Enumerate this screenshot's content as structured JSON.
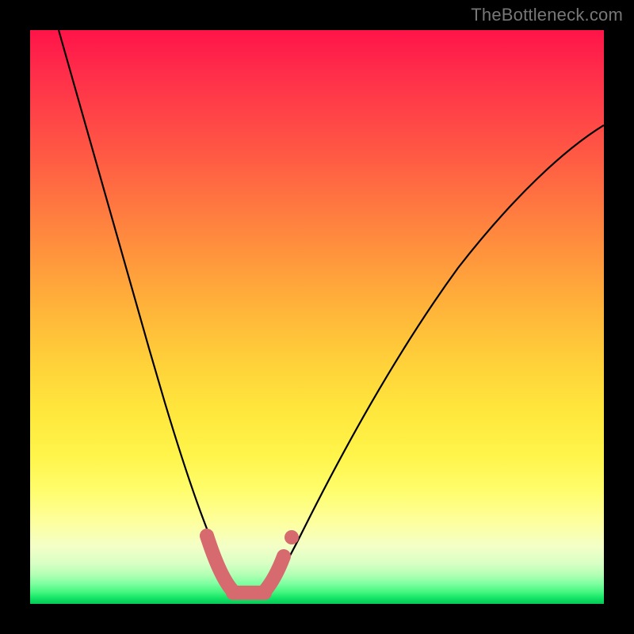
{
  "watermark": "TheBottleneck.com",
  "chart_data": {
    "type": "line",
    "title": "",
    "xlabel": "",
    "ylabel": "",
    "xlim": [
      0,
      100
    ],
    "ylim": [
      0,
      100
    ],
    "grid": false,
    "series": [
      {
        "name": "bottleneck-curve",
        "x": [
          5,
          8,
          11,
          14,
          17,
          20,
          23,
          26,
          28,
          30,
          31,
          32,
          33,
          34,
          35,
          36,
          37,
          38,
          40,
          42,
          45,
          50,
          55,
          60,
          65,
          70,
          75,
          80,
          85,
          90,
          95,
          100
        ],
        "y": [
          100,
          90,
          80,
          70,
          60,
          51,
          42,
          33,
          25,
          18,
          14,
          11,
          8,
          6,
          4,
          3,
          2.2,
          2,
          2,
          2.5,
          4,
          8,
          14,
          21,
          28,
          35,
          42,
          49,
          55,
          61,
          66,
          71
        ]
      },
      {
        "name": "trough-highlight",
        "x": [
          30,
          31,
          32,
          33,
          34,
          35,
          36,
          37,
          38,
          39,
          40,
          41,
          42
        ],
        "y": [
          14,
          10,
          7,
          5,
          3.5,
          2.5,
          2,
          2,
          2,
          2.3,
          3,
          4,
          5.5
        ]
      }
    ],
    "colors": {
      "curve": "#000000",
      "highlight": "#d66a6f",
      "gradient_top": "#ff1449",
      "gradient_mid": "#ffe63c",
      "gradient_bottom": "#07c859",
      "frame": "#000000"
    }
  }
}
